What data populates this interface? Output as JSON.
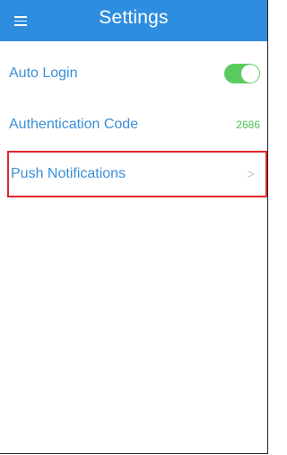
{
  "header": {
    "title": "Settings",
    "menu_icon": "menu-icon",
    "background_color": "#2e8ddf"
  },
  "settings": {
    "auto_login": {
      "label": "Auto Login",
      "enabled": true,
      "toggle_color": "#5ccb5f"
    },
    "authentication_code": {
      "label": "Authentication Code",
      "value": "2686",
      "value_color": "#52c05a"
    },
    "push_notifications": {
      "label": "Push Notifications",
      "chevron": ">",
      "highlight_color": "#e0262a"
    }
  },
  "colors": {
    "label": "#3a8fd8"
  }
}
